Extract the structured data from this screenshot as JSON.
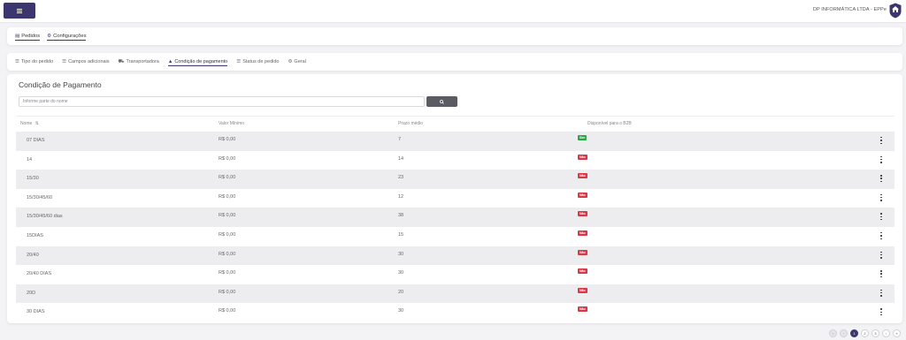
{
  "header": {
    "company": "DP INFORMÁTICA LTDA - EPPe",
    "menu_icon": "hamburger-icon",
    "logo_icon": "house-shield-logo"
  },
  "top_tabs": [
    {
      "label": "Pedidos",
      "icon": "document-icon",
      "active": true
    },
    {
      "label": "Configurações",
      "icon": "gear-icon",
      "active": true
    }
  ],
  "sub_tabs": [
    {
      "label": "Tipo do pedido",
      "icon": "list-icon"
    },
    {
      "label": "Campos adicionais",
      "icon": "list-icon"
    },
    {
      "label": "Transportadora",
      "icon": "truck-icon"
    },
    {
      "label": "Condição de pagamento",
      "icon": "hand-coin-icon",
      "active": true
    },
    {
      "label": "Status de pedido",
      "icon": "list-icon"
    },
    {
      "label": "Geral",
      "icon": "gear-icon"
    }
  ],
  "page": {
    "title": "Condição de Pagamento",
    "search_placeholder": "Informe parte do nome"
  },
  "table": {
    "columns": [
      "Nome",
      "Valor Mínimo",
      "Prazo médio",
      "Disponível para o B2B"
    ],
    "rows": [
      {
        "nome": "07 DIAS",
        "valor": "R$ 0,00",
        "prazo": "7",
        "b2b": "Sim"
      },
      {
        "nome": "14",
        "valor": "R$ 0,00",
        "prazo": "14",
        "b2b": "Não"
      },
      {
        "nome": "15/30",
        "valor": "R$ 0,00",
        "prazo": "23",
        "b2b": "Não"
      },
      {
        "nome": "15/30/45/60",
        "valor": "R$ 0,00",
        "prazo": "12",
        "b2b": "Não"
      },
      {
        "nome": "15/30/45/60 dias",
        "valor": "R$ 0,00",
        "prazo": "38",
        "b2b": "Não"
      },
      {
        "nome": "15DIAS",
        "valor": "R$ 0,00",
        "prazo": "15",
        "b2b": "Não"
      },
      {
        "nome": "20/40",
        "valor": "R$ 0,00",
        "prazo": "30",
        "b2b": "Não"
      },
      {
        "nome": "20/40 DIAS",
        "valor": "R$ 0,00",
        "prazo": "30",
        "b2b": "Não"
      },
      {
        "nome": "20D",
        "valor": "R$ 0,00",
        "prazo": "20",
        "b2b": "Não"
      },
      {
        "nome": "30 DIAS",
        "valor": "R$ 0,00",
        "prazo": "30",
        "b2b": "Não"
      }
    ]
  },
  "pagination": {
    "first": "«",
    "prev": "‹",
    "pages": [
      "1",
      "2",
      "3"
    ],
    "current": "1",
    "next": "›",
    "last": "»"
  },
  "colors": {
    "primary": "#3b376e",
    "success": "#28a745",
    "danger": "#dc3545"
  }
}
